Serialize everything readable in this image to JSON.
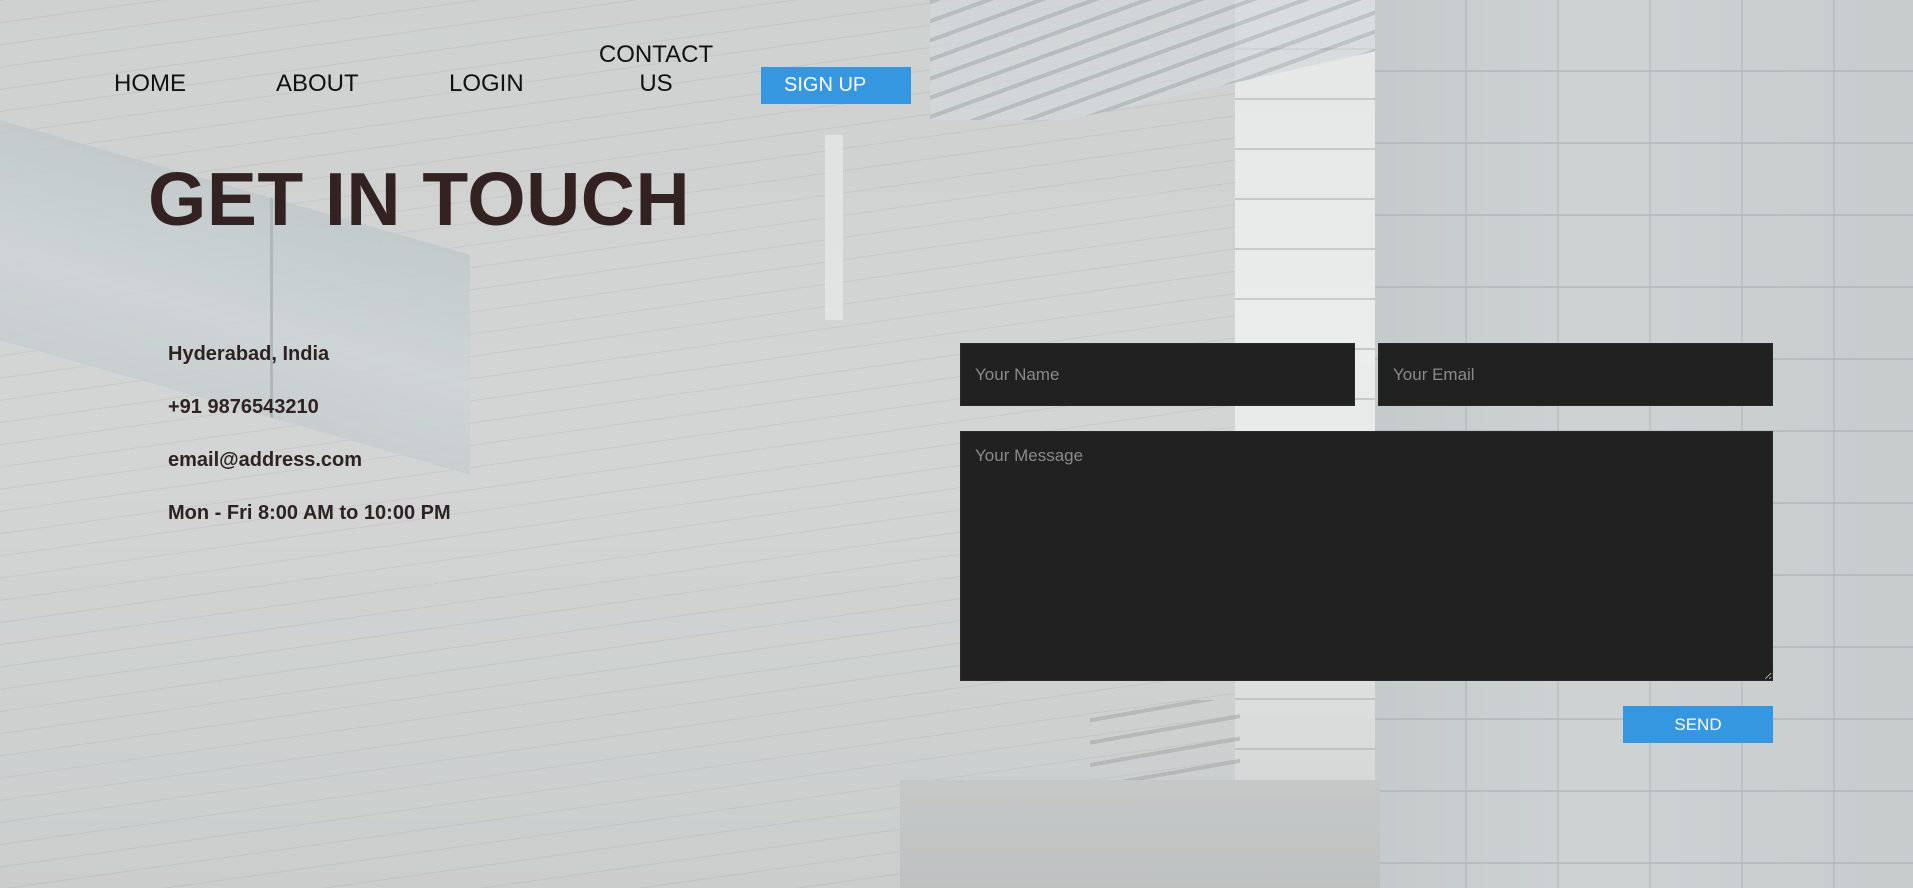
{
  "nav": {
    "home": "HOME",
    "about": "ABOUT",
    "login": "LOGIN",
    "contact": "CONTACT US",
    "signup": "SIGN UP"
  },
  "heading": "GET IN TOUCH",
  "contact_info": {
    "location": "Hyderabad, India",
    "phone": "+91 9876543210",
    "email": "email@address.com",
    "hours": "Mon - Fri 8:00 AM to 10:00 PM"
  },
  "form": {
    "name_placeholder": "Your Name",
    "email_placeholder": "Your Email",
    "message_placeholder": "Your Message",
    "send_label": "SEND"
  },
  "colors": {
    "accent": "#3597e0",
    "heading": "#322222",
    "input_bg": "#212121"
  }
}
